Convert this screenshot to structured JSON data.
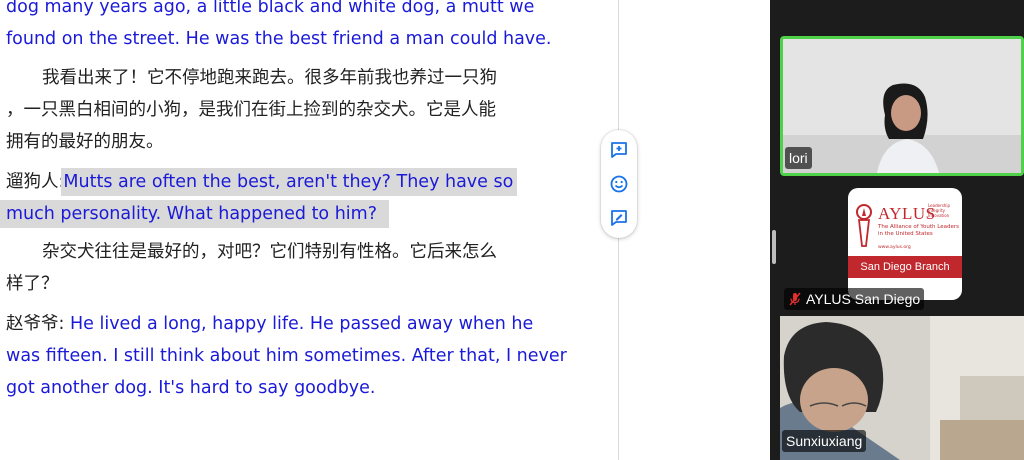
{
  "document": {
    "lines": [
      {
        "text": "dog many years ago, a little black and white dog, a mutt we",
        "lang": "en"
      },
      {
        "text": "found on the street. He was the best friend a man could have.",
        "lang": "en"
      },
      {
        "text": "我看出来了！它不停地跑来跑去。很多年前我也养过一只狗",
        "lang": "zh"
      },
      {
        "text": "，一只黑白相间的小狗，是我们在街上捡到的杂交犬。它是人能",
        "lang": "zh"
      },
      {
        "text": "拥有的最好的朋友。",
        "lang": "zh"
      },
      {
        "speaker": "遛狗人:",
        "text": "Mutts are often the best, aren't they? They have so",
        "lang": "en",
        "highlighted": true
      },
      {
        "text": "much personality. What happened to him?",
        "lang": "en",
        "highlighted": true
      },
      {
        "text": "杂交犬往往是最好的，对吧？它们特别有性格。它后来怎么",
        "lang": "zh"
      },
      {
        "text": "样了？",
        "lang": "zh"
      },
      {
        "speaker": "赵爷爷:",
        "text": "He lived a long, happy life. He passed away when he",
        "lang": "en"
      },
      {
        "text": "was fifteen. I still think about him sometimes. After that, I never",
        "lang": "en"
      },
      {
        "text": "got another dog. It's hard to say goodbye.",
        "lang": "en"
      }
    ]
  },
  "floating_toolbar": {
    "buttons": [
      {
        "icon": "add-comment-icon"
      },
      {
        "icon": "emoji-icon"
      },
      {
        "icon": "suggest-edit-icon"
      }
    ]
  },
  "participants": [
    {
      "name": "lori",
      "active_speaker": true,
      "muted": false
    },
    {
      "name": "AYLUS San Diego",
      "active_speaker": false,
      "muted": true
    },
    {
      "name": "Sunxiuxiang",
      "active_speaker": false,
      "muted": false
    }
  ],
  "aylus_logo": {
    "word": "AYLUS",
    "tagline": "Leadership Integrity Innovation",
    "subtitle": "The Alliance of Youth Leaders in the United States",
    "url": "www.aylus.org",
    "band": "San Diego Branch"
  },
  "colors": {
    "english_text": "#1a1ad8",
    "active_speaker_border": "#4fd14a",
    "aylus_red": "#c0282d",
    "highlight": "#d9d9d9"
  }
}
